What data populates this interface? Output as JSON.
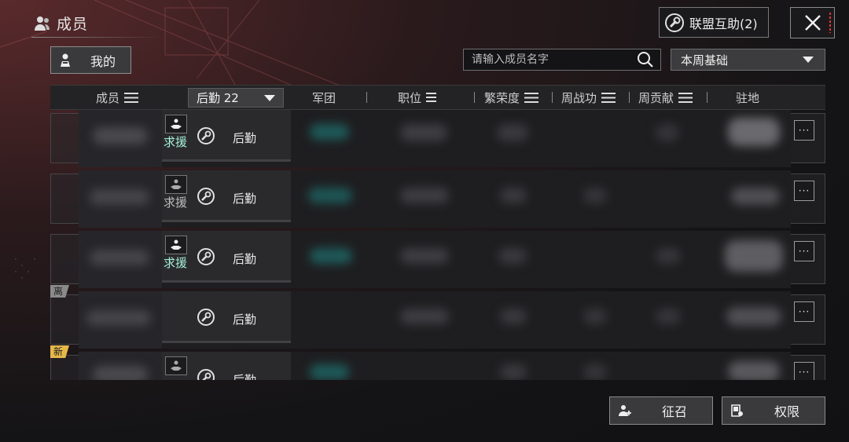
{
  "header": {
    "title": "成员",
    "assist_label": "联盟互助(2)"
  },
  "filters": {
    "mine_label": "我的",
    "search_placeholder": "请输入成员名字",
    "period_selected": "本周基础"
  },
  "table": {
    "columns": {
      "member": "成员",
      "role_filter": "后勤 22",
      "legion": "军团",
      "position": "职位",
      "prosperity": "繁荣度",
      "weekly_battle": "周战功",
      "weekly_contribution": "周贡献",
      "station": "驻地"
    },
    "rows": [
      {
        "help_label": "求援",
        "help_active": true,
        "role": "后勤",
        "tag": ""
      },
      {
        "help_label": "求援",
        "help_active": false,
        "role": "后勤",
        "tag": ""
      },
      {
        "help_label": "求援",
        "help_active": true,
        "role": "后勤",
        "tag": ""
      },
      {
        "help_label": "",
        "help_active": false,
        "role": "后勤",
        "tag": "离"
      },
      {
        "help_label": "",
        "help_active": false,
        "role": "后勤",
        "tag": "新"
      }
    ],
    "more_label": "···"
  },
  "footer": {
    "recruit_label": "征召",
    "permission_label": "权限"
  },
  "colors": {
    "help_active": "#a6f0d6",
    "help_inactive": "#bdbdbd",
    "tag_new": "#e6b84a",
    "tag_leave": "#8a8a8a"
  }
}
